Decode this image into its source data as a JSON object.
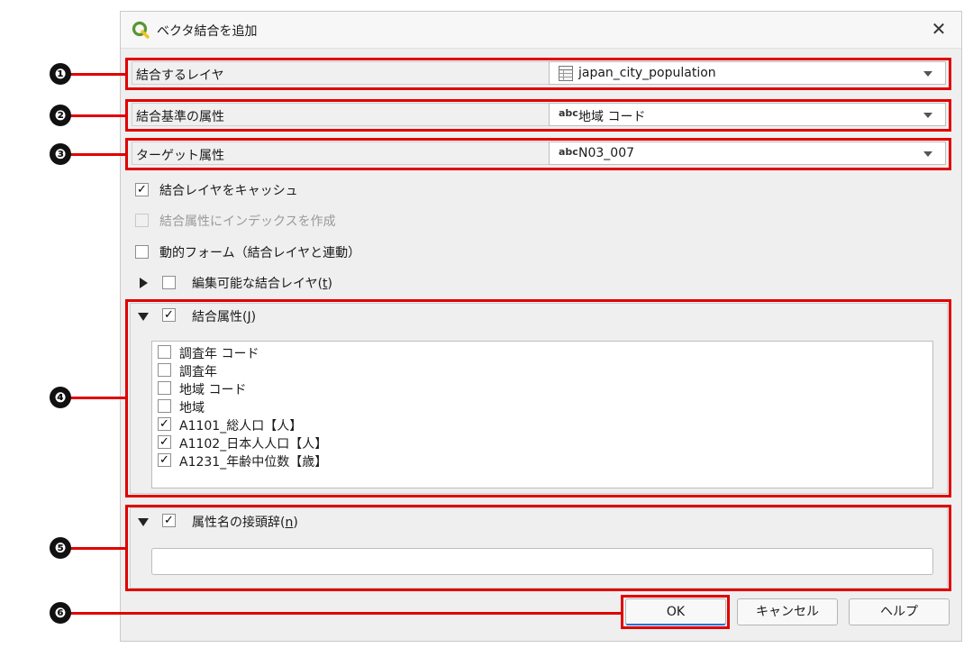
{
  "dialog": {
    "title": "ベクタ結合を追加",
    "close_glyph": "✕"
  },
  "rows": {
    "join_layer": {
      "label": "結合するレイヤ",
      "value": "japan_city_population"
    },
    "join_field": {
      "label": "結合基準の属性",
      "type_badge": "abc",
      "value": "地域 コード"
    },
    "target_field": {
      "label": "ターゲット属性",
      "type_badge": "abc",
      "value": "N03_007"
    }
  },
  "options": {
    "cache": {
      "label": "結合レイヤをキャッシュ",
      "checked": true
    },
    "index": {
      "label": "結合属性にインデックスを作成",
      "checked": false,
      "disabled": true
    },
    "dynamic_form": {
      "label": "動的フォーム（結合レイヤと連動）",
      "checked": false
    },
    "editable": {
      "label_prefix": "編集可能な結合レイヤ(",
      "label_key": "t",
      "label_suffix": ")",
      "checked": false
    }
  },
  "joined_fields": {
    "label_prefix": "結合属性(",
    "label_key": "J",
    "label_suffix": ")",
    "checked": true,
    "items": [
      {
        "label": "調査年 コード",
        "checked": false
      },
      {
        "label": "調査年",
        "checked": false
      },
      {
        "label": "地域 コード",
        "checked": false
      },
      {
        "label": "地域",
        "checked": false
      },
      {
        "label": "A1101_総人口【人】",
        "checked": true
      },
      {
        "label": "A1102_日本人人口【人】",
        "checked": true
      },
      {
        "label": "A1231_年齢中位数【歳】",
        "checked": true
      }
    ]
  },
  "prefix": {
    "label_prefix": "属性名の接頭辞(",
    "label_key": "n",
    "label_suffix": ")",
    "checked": true,
    "value": ""
  },
  "buttons": {
    "ok": "OK",
    "cancel": "キャンセル",
    "help": "ヘルプ"
  },
  "callouts": [
    "❶",
    "❷",
    "❸",
    "❹",
    "❺",
    "❻"
  ],
  "colors": {
    "callout_red": "#e00000",
    "qgis_green": "#589632",
    "qgis_yellow": "#f0c419"
  },
  "icons": {
    "layer": "table-icon",
    "logo": "qgis-logo"
  }
}
